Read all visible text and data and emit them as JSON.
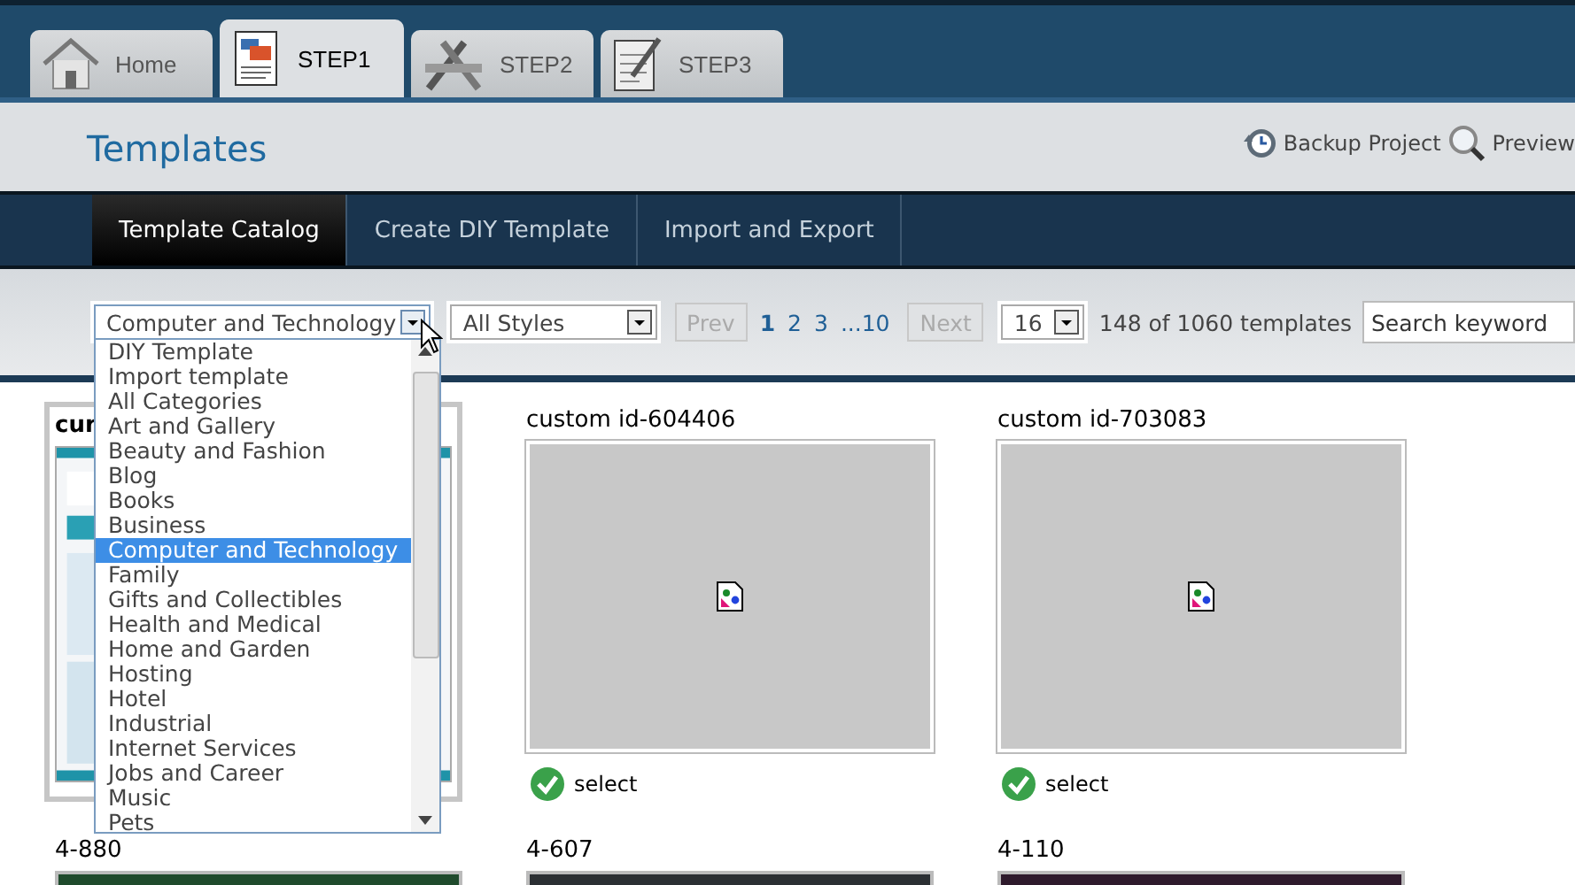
{
  "tabs": [
    {
      "label": "Home",
      "kind": "home",
      "selected": false
    },
    {
      "label": "STEP1",
      "kind": "document",
      "selected": true
    },
    {
      "label": "STEP2",
      "kind": "tools",
      "selected": false
    },
    {
      "label": "STEP3",
      "kind": "edit",
      "selected": false
    }
  ],
  "header": {
    "title": "Templates",
    "actions": [
      {
        "label": "Backup Project",
        "kind": "backup"
      },
      {
        "label": "Preview",
        "kind": "preview"
      }
    ]
  },
  "subnav": [
    {
      "label": "Template Catalog",
      "selected": true
    },
    {
      "label": "Create DIY Template",
      "selected": false
    },
    {
      "label": "Import and Export",
      "selected": false
    }
  ],
  "filters": {
    "category": "Computer and Technology",
    "style": "All Styles",
    "prev": {
      "label": "Prev",
      "disabled": true
    },
    "pages": [
      {
        "label": "1",
        "selected": true
      },
      {
        "label": "2",
        "selected": false
      },
      {
        "label": "3",
        "selected": false
      },
      {
        "label": "...10",
        "selected": false
      }
    ],
    "next": {
      "label": "Next",
      "disabled": true
    },
    "per_page": "16",
    "count": "148 of 1060 templates",
    "search": {
      "placeholder": "Search keyword"
    }
  },
  "dropdown": {
    "expanded": true,
    "options": [
      {
        "label": "DIY Template",
        "selected": false
      },
      {
        "label": "Import template",
        "selected": false
      },
      {
        "label": "All Categories",
        "selected": false
      },
      {
        "label": "Art and Gallery",
        "selected": false
      },
      {
        "label": "Beauty and Fashion",
        "selected": false
      },
      {
        "label": "Blog",
        "selected": false
      },
      {
        "label": "Books",
        "selected": false
      },
      {
        "label": "Business",
        "selected": false
      },
      {
        "label": "Computer and Technology",
        "selected": true
      },
      {
        "label": "Family",
        "selected": false
      },
      {
        "label": "Gifts and Collectibles",
        "selected": false
      },
      {
        "label": "Health and Medical",
        "selected": false
      },
      {
        "label": "Home and Garden",
        "selected": false
      },
      {
        "label": "Hosting",
        "selected": false
      },
      {
        "label": "Hotel",
        "selected": false
      },
      {
        "label": "Industrial",
        "selected": false
      },
      {
        "label": "Internet Services",
        "selected": false
      },
      {
        "label": "Jobs and Career",
        "selected": false
      },
      {
        "label": "Music",
        "selected": false
      },
      {
        "label": "Pets",
        "selected": false
      }
    ]
  },
  "cards": [
    {
      "title": "cur",
      "kind": "thumbnail",
      "highlighted": true
    },
    {
      "title": "custom id-604406",
      "kind": "broken",
      "highlighted": false,
      "select": "select"
    },
    {
      "title": "custom id-703083",
      "kind": "broken",
      "highlighted": false,
      "select": "select"
    },
    {
      "title": "4-880",
      "kind": "picture",
      "highlighted": false
    },
    {
      "title": "4-607",
      "kind": "picture",
      "highlighted": false
    },
    {
      "title": "4-110",
      "kind": "picture",
      "highlighted": false
    }
  ]
}
